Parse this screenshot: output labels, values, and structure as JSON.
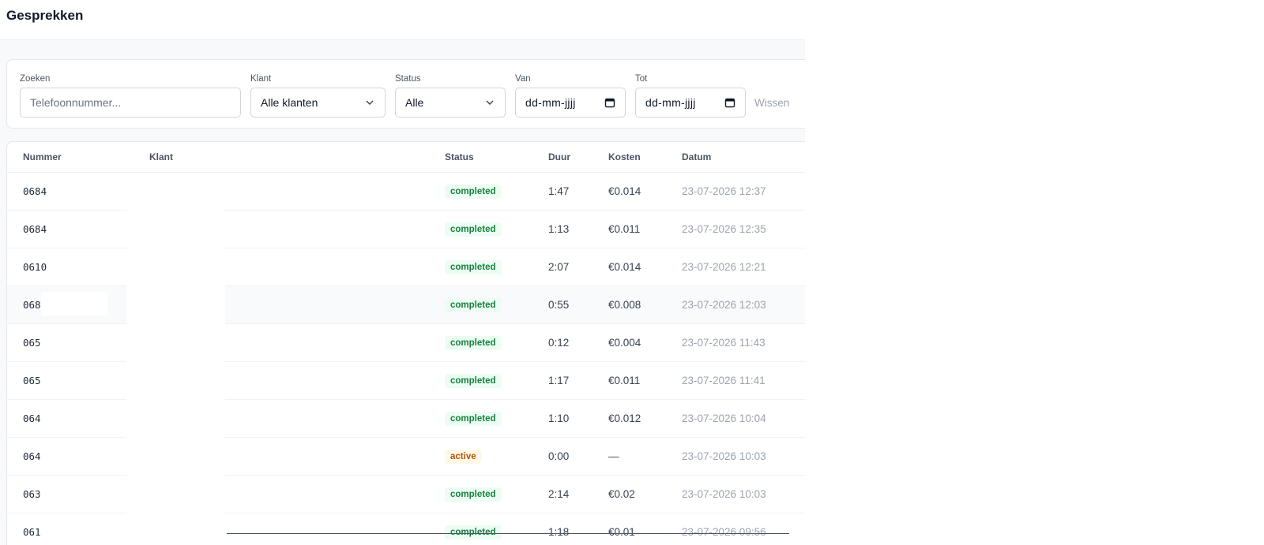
{
  "header": {
    "title": "Gesprekken"
  },
  "filters": {
    "search": {
      "label": "Zoeken",
      "placeholder": "Telefoonnummer..."
    },
    "client": {
      "label": "Klant",
      "value": "Alle klanten"
    },
    "status": {
      "label": "Status",
      "value": "Alle"
    },
    "from": {
      "label": "Van",
      "value": "dd-mm-jjjj"
    },
    "to": {
      "label": "Tot",
      "value": "dd-mm-jjjj"
    },
    "clear_label": "Wissen"
  },
  "table": {
    "columns": {
      "number": "Nummer",
      "client": "Klant",
      "status": "Status",
      "duration": "Duur",
      "cost": "Kosten",
      "date": "Datum"
    },
    "rows": [
      {
        "number": "0684",
        "client": "",
        "status": "completed",
        "duration": "1:47",
        "cost": "€0.014",
        "date": "23-07-2026 12:37"
      },
      {
        "number": "0684",
        "client": "",
        "status": "completed",
        "duration": "1:13",
        "cost": "€0.011",
        "date": "23-07-2026 12:35"
      },
      {
        "number": "0610",
        "client": "",
        "status": "completed",
        "duration": "2:07",
        "cost": "€0.014",
        "date": "23-07-2026 12:21"
      },
      {
        "number": "068",
        "client": "",
        "status": "completed",
        "duration": "0:55",
        "cost": "€0.008",
        "date": "23-07-2026 12:03"
      },
      {
        "number": "065",
        "client": "",
        "status": "completed",
        "duration": "0:12",
        "cost": "€0.004",
        "date": "23-07-2026 11:43"
      },
      {
        "number": "065",
        "client": "",
        "status": "completed",
        "duration": "1:17",
        "cost": "€0.011",
        "date": "23-07-2026 11:41"
      },
      {
        "number": "064",
        "client": "",
        "status": "completed",
        "duration": "1:10",
        "cost": "€0.012",
        "date": "23-07-2026 10:04"
      },
      {
        "number": "064",
        "client": "",
        "status": "active",
        "duration": "0:00",
        "cost": "—",
        "date": "23-07-2026 10:03"
      },
      {
        "number": "063",
        "client": "",
        "status": "completed",
        "duration": "2:14",
        "cost": "€0.02",
        "date": "23-07-2026 10:03"
      },
      {
        "number": "061",
        "client": "",
        "status": "completed",
        "duration": "1:18",
        "cost": "€0.01",
        "date": "23-07-2026 09:56"
      }
    ]
  },
  "colors": {
    "completed_bg": "#ecfdf3",
    "completed_text": "#16803c",
    "active_bg": "#fef9e7",
    "active_text": "#b45309"
  }
}
